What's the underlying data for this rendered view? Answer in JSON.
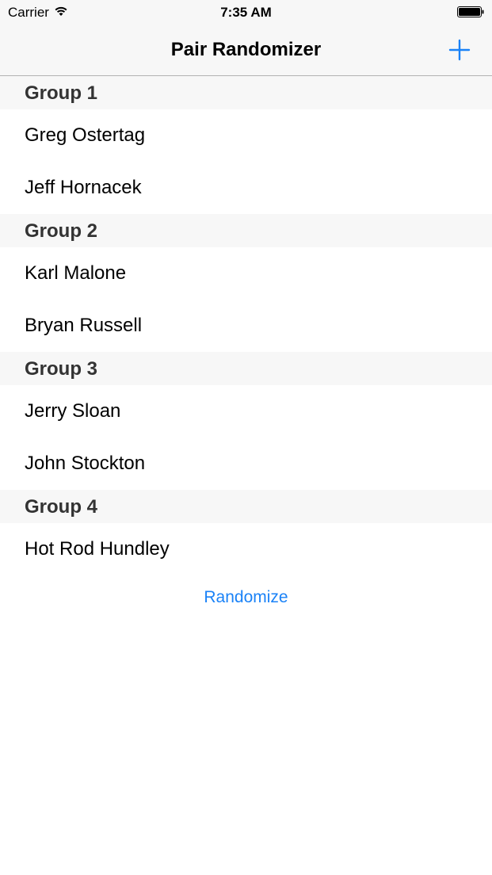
{
  "status_bar": {
    "carrier": "Carrier",
    "time": "7:35 AM",
    "icons": [
      "wifi-icon",
      "battery-icon"
    ]
  },
  "nav": {
    "title": "Pair Randomizer",
    "add_icon": "plus-icon",
    "accent_color": "#1a82f7"
  },
  "groups": [
    {
      "title": "Group 1",
      "members": [
        "Greg Ostertag",
        "Jeff Hornacek"
      ]
    },
    {
      "title": "Group 2",
      "members": [
        "Karl Malone",
        "Bryan Russell"
      ]
    },
    {
      "title": "Group 3",
      "members": [
        "Jerry Sloan",
        "John Stockton"
      ]
    },
    {
      "title": "Group 4",
      "members": [
        "Hot Rod Hundley"
      ]
    }
  ],
  "actions": {
    "randomize_label": "Randomize"
  }
}
